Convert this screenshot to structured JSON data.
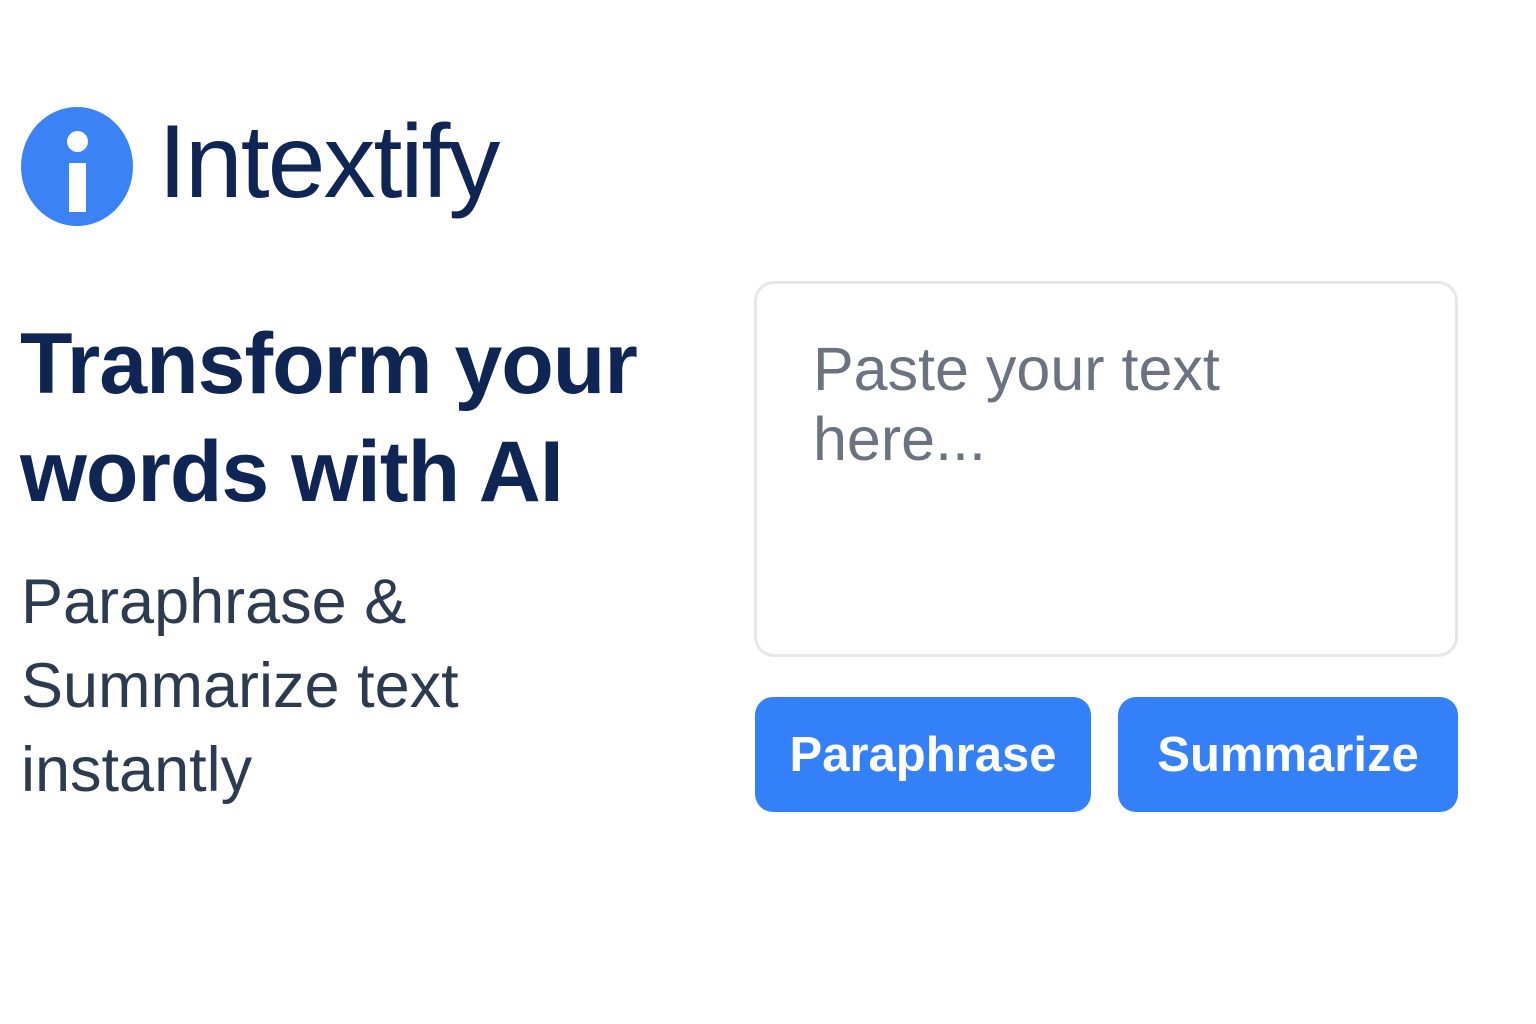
{
  "brand": {
    "name": "Intextify",
    "icon": "info-icon",
    "icon_color": "#3b82f6",
    "text_color": "#0f2554"
  },
  "hero": {
    "headline": "Transform your words with AI",
    "subtext": "Paraphrase & Summarize text instantly"
  },
  "editor": {
    "placeholder": "Paste your text here...",
    "value": ""
  },
  "actions": {
    "paraphrase_label": "Paraphrase",
    "summarize_label": "Summarize",
    "button_color": "#3480f9"
  }
}
